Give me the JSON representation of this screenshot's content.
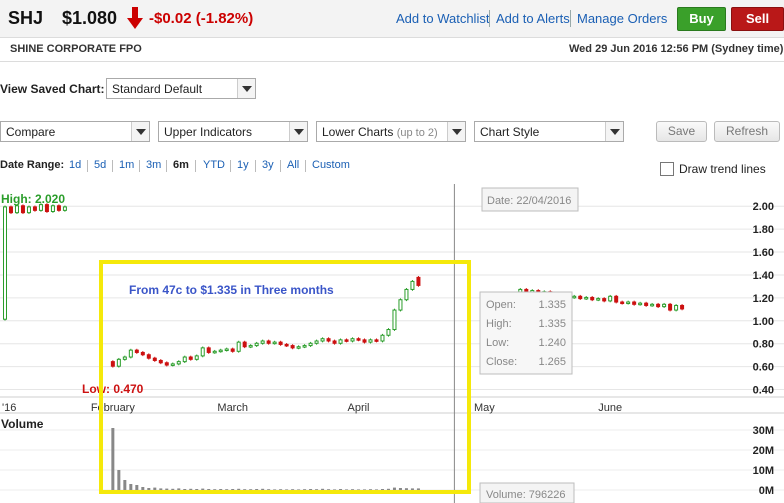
{
  "quote": {
    "ticker": "SHJ",
    "price": "$1.080",
    "change": "-$0.02 (-1.82%)",
    "change_color": "#cc0000",
    "direction_icon": "down-arrow-icon"
  },
  "header_links": [
    "Add to Watchlist",
    "Add to Alerts",
    "Manage Orders"
  ],
  "buttons": {
    "buy": "Buy",
    "sell": "Sell",
    "buy_color": "#3aa02a",
    "sell_color": "#b91818"
  },
  "company": {
    "name": "SHINE CORPORATE FPO",
    "timestamp": "Wed 29 Jun 2016 12:56 PM (Sydney time)"
  },
  "saved_chart": {
    "label": "View Saved Chart:",
    "value": "Standard Default"
  },
  "controls": {
    "compare": "Compare",
    "upper_indicators": "Upper Indicators",
    "lower_charts": "Lower Charts",
    "lower_charts_hint": "(up to 2)",
    "chart_style": "Chart Style",
    "save": "Save",
    "refresh": "Refresh"
  },
  "date_range": {
    "label": "Date Range:",
    "options": [
      "1d",
      "5d",
      "1m",
      "3m",
      "6m",
      "YTD",
      "1y",
      "3y",
      "All",
      "Custom"
    ],
    "selected": "6m"
  },
  "trend_lines": {
    "label": "Draw trend lines",
    "checked": false
  },
  "chart_data": {
    "type": "candlestick",
    "price_ticks": [
      "2.00",
      "1.80",
      "1.60",
      "1.40",
      "1.20",
      "1.00",
      "0.80",
      "0.60",
      "0.40"
    ],
    "price_tick_values": [
      2.0,
      1.8,
      1.6,
      1.4,
      1.2,
      1.0,
      0.8,
      0.6,
      0.4
    ],
    "ylim": [
      0.3,
      2.15
    ],
    "x_labels": [
      "'16",
      "February",
      "March",
      "April",
      "May",
      "June"
    ],
    "x_label_day_index": [
      0,
      18,
      38,
      59,
      80,
      101
    ],
    "total_days": 124,
    "volume_label": "Volume",
    "volume_ticks": [
      "30M",
      "20M",
      "10M",
      "0M"
    ],
    "volume_tick_values": [
      30,
      20,
      10,
      0
    ],
    "volume_ylim": [
      0,
      34
    ],
    "high_label": "High: 2.020",
    "low_label": "Low: 0.470",
    "annotation": "From 47c to $1.335 in Three  months",
    "tooltip": {
      "date": "Date: 22/04/2016",
      "open_label": "Open:",
      "open": "1.335",
      "high_label": "High:",
      "high": "1.335",
      "low_label": "Low:",
      "low": "1.240",
      "close_label": "Close:",
      "close": "1.265",
      "volume": "Volume: 796226"
    },
    "crosshair_day": 75,
    "up_color": "#2a9d2a",
    "down_color": "#cc1111",
    "highlight_color": "#f5e90a",
    "candles": [
      [
        0,
        0.97,
        1.95
      ],
      [
        1,
        1.95,
        1.9
      ],
      [
        2,
        1.9,
        1.96
      ],
      [
        3,
        1.96,
        1.9
      ],
      [
        4,
        1.9,
        1.95
      ],
      [
        5,
        1.95,
        1.92
      ],
      [
        6,
        1.92,
        1.97
      ],
      [
        7,
        1.97,
        1.91
      ],
      [
        8,
        1.91,
        1.96
      ],
      [
        9,
        1.96,
        1.92
      ],
      [
        10,
        1.92,
        1.95
      ],
      [
        18,
        0.6,
        0.56
      ],
      [
        19,
        0.56,
        0.62
      ],
      [
        20,
        0.62,
        0.64
      ],
      [
        21,
        0.64,
        0.7
      ],
      [
        22,
        0.7,
        0.68
      ],
      [
        23,
        0.68,
        0.66
      ],
      [
        24,
        0.66,
        0.63
      ],
      [
        25,
        0.63,
        0.61
      ],
      [
        26,
        0.61,
        0.59
      ],
      [
        27,
        0.59,
        0.57
      ],
      [
        28,
        0.57,
        0.58
      ],
      [
        29,
        0.58,
        0.6
      ],
      [
        30,
        0.6,
        0.64
      ],
      [
        31,
        0.64,
        0.62
      ],
      [
        32,
        0.62,
        0.65
      ],
      [
        33,
        0.65,
        0.72
      ],
      [
        34,
        0.72,
        0.68
      ],
      [
        35,
        0.68,
        0.69
      ],
      [
        36,
        0.69,
        0.7
      ],
      [
        37,
        0.7,
        0.71
      ],
      [
        38,
        0.71,
        0.69
      ],
      [
        39,
        0.69,
        0.77
      ],
      [
        40,
        0.77,
        0.73
      ],
      [
        41,
        0.73,
        0.74
      ],
      [
        42,
        0.74,
        0.76
      ],
      [
        43,
        0.76,
        0.78
      ],
      [
        44,
        0.78,
        0.76
      ],
      [
        45,
        0.76,
        0.77
      ],
      [
        46,
        0.77,
        0.75
      ],
      [
        47,
        0.75,
        0.74
      ],
      [
        48,
        0.74,
        0.72
      ],
      [
        49,
        0.72,
        0.73
      ],
      [
        50,
        0.73,
        0.74
      ],
      [
        51,
        0.74,
        0.76
      ],
      [
        52,
        0.76,
        0.78
      ],
      [
        53,
        0.78,
        0.8
      ],
      [
        54,
        0.8,
        0.78
      ],
      [
        55,
        0.78,
        0.76
      ],
      [
        56,
        0.76,
        0.79
      ],
      [
        57,
        0.79,
        0.78
      ],
      [
        58,
        0.78,
        0.8
      ],
      [
        59,
        0.8,
        0.79
      ],
      [
        60,
        0.79,
        0.77
      ],
      [
        61,
        0.77,
        0.79
      ],
      [
        62,
        0.79,
        0.78
      ],
      [
        63,
        0.78,
        0.83
      ],
      [
        64,
        0.83,
        0.88
      ],
      [
        65,
        0.88,
        1.05
      ],
      [
        66,
        1.05,
        1.14
      ],
      [
        67,
        1.14,
        1.23
      ],
      [
        68,
        1.23,
        1.3
      ],
      [
        69,
        1.335,
        1.265
      ],
      [
        81,
        1.2,
        1.16
      ],
      [
        82,
        1.16,
        1.15
      ],
      [
        83,
        1.15,
        1.17
      ],
      [
        84,
        1.17,
        1.14
      ],
      [
        85,
        1.14,
        1.16
      ],
      [
        86,
        1.16,
        1.23
      ],
      [
        87,
        1.23,
        1.21
      ],
      [
        88,
        1.21,
        1.22
      ],
      [
        89,
        1.22,
        1.2
      ],
      [
        90,
        1.2,
        1.21
      ],
      [
        91,
        1.21,
        1.19
      ],
      [
        92,
        1.19,
        1.2
      ],
      [
        93,
        1.2,
        1.18
      ],
      [
        94,
        1.18,
        1.16
      ],
      [
        95,
        1.16,
        1.17
      ],
      [
        96,
        1.17,
        1.15
      ],
      [
        97,
        1.15,
        1.16
      ],
      [
        98,
        1.16,
        1.14
      ],
      [
        99,
        1.14,
        1.15
      ],
      [
        100,
        1.15,
        1.13
      ],
      [
        101,
        1.13,
        1.17
      ],
      [
        102,
        1.17,
        1.12
      ],
      [
        103,
        1.12,
        1.11
      ],
      [
        104,
        1.11,
        1.12
      ],
      [
        105,
        1.12,
        1.1
      ],
      [
        106,
        1.1,
        1.11
      ],
      [
        107,
        1.11,
        1.09
      ],
      [
        108,
        1.09,
        1.1
      ],
      [
        109,
        1.1,
        1.08
      ],
      [
        110,
        1.08,
        1.1
      ],
      [
        111,
        1.1,
        1.05
      ],
      [
        112,
        1.05,
        1.09
      ],
      [
        113,
        1.09,
        1.06
      ]
    ],
    "volumes": [
      [
        18,
        31
      ],
      [
        19,
        10
      ],
      [
        20,
        5
      ],
      [
        21,
        3
      ],
      [
        22,
        2.5
      ],
      [
        23,
        1.5
      ],
      [
        24,
        1
      ],
      [
        25,
        1.2
      ],
      [
        26,
        0.8
      ],
      [
        27,
        0.7
      ],
      [
        28,
        0.6
      ],
      [
        29,
        0.8
      ],
      [
        30,
        0.5
      ],
      [
        31,
        0.6
      ],
      [
        32,
        0.5
      ],
      [
        33,
        0.7
      ],
      [
        34,
        0.5
      ],
      [
        35,
        0.4
      ],
      [
        36,
        0.5
      ],
      [
        37,
        0.4
      ],
      [
        38,
        0.5
      ],
      [
        39,
        0.6
      ],
      [
        40,
        0.4
      ],
      [
        41,
        0.4
      ],
      [
        42,
        0.5
      ],
      [
        43,
        0.6
      ],
      [
        44,
        0.4
      ],
      [
        45,
        0.3
      ],
      [
        46,
        0.4
      ],
      [
        47,
        0.3
      ],
      [
        48,
        0.4
      ],
      [
        49,
        0.3
      ],
      [
        50,
        0.4
      ],
      [
        51,
        0.5
      ],
      [
        52,
        0.4
      ],
      [
        53,
        0.6
      ],
      [
        54,
        0.4
      ],
      [
        55,
        0.3
      ],
      [
        56,
        0.5
      ],
      [
        57,
        0.3
      ],
      [
        58,
        0.4
      ],
      [
        59,
        0.3
      ],
      [
        60,
        0.3
      ],
      [
        61,
        0.4
      ],
      [
        62,
        0.3
      ],
      [
        63,
        0.5
      ],
      [
        64,
        0.6
      ],
      [
        65,
        1.2
      ],
      [
        66,
        1.0
      ],
      [
        67,
        0.9
      ],
      [
        68,
        0.8
      ],
      [
        69,
        0.8
      ]
    ]
  }
}
